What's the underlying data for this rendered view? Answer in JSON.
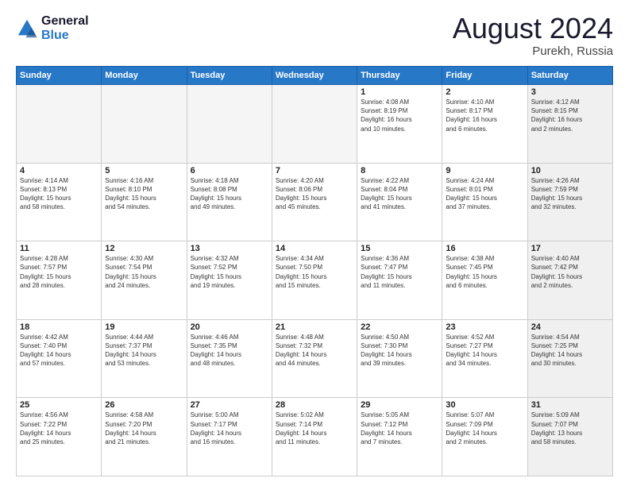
{
  "logo": {
    "line1": "General",
    "line2": "Blue"
  },
  "title": "August 2024",
  "subtitle": "Purekh, Russia",
  "days_header": [
    "Sunday",
    "Monday",
    "Tuesday",
    "Wednesday",
    "Thursday",
    "Friday",
    "Saturday"
  ],
  "weeks": [
    [
      {
        "day": "",
        "info": "",
        "empty": true
      },
      {
        "day": "",
        "info": "",
        "empty": true
      },
      {
        "day": "",
        "info": "",
        "empty": true
      },
      {
        "day": "",
        "info": "",
        "empty": true
      },
      {
        "day": "1",
        "info": "Sunrise: 4:08 AM\nSunset: 8:19 PM\nDaylight: 16 hours\nand 10 minutes."
      },
      {
        "day": "2",
        "info": "Sunrise: 4:10 AM\nSunset: 8:17 PM\nDaylight: 16 hours\nand 6 minutes."
      },
      {
        "day": "3",
        "info": "Sunrise: 4:12 AM\nSunset: 8:15 PM\nDaylight: 16 hours\nand 2 minutes.",
        "shaded": true
      }
    ],
    [
      {
        "day": "4",
        "info": "Sunrise: 4:14 AM\nSunset: 8:13 PM\nDaylight: 15 hours\nand 58 minutes."
      },
      {
        "day": "5",
        "info": "Sunrise: 4:16 AM\nSunset: 8:10 PM\nDaylight: 15 hours\nand 54 minutes."
      },
      {
        "day": "6",
        "info": "Sunrise: 4:18 AM\nSunset: 8:08 PM\nDaylight: 15 hours\nand 49 minutes."
      },
      {
        "day": "7",
        "info": "Sunrise: 4:20 AM\nSunset: 8:06 PM\nDaylight: 15 hours\nand 45 minutes."
      },
      {
        "day": "8",
        "info": "Sunrise: 4:22 AM\nSunset: 8:04 PM\nDaylight: 15 hours\nand 41 minutes."
      },
      {
        "day": "9",
        "info": "Sunrise: 4:24 AM\nSunset: 8:01 PM\nDaylight: 15 hours\nand 37 minutes."
      },
      {
        "day": "10",
        "info": "Sunrise: 4:26 AM\nSunset: 7:59 PM\nDaylight: 15 hours\nand 32 minutes.",
        "shaded": true
      }
    ],
    [
      {
        "day": "11",
        "info": "Sunrise: 4:28 AM\nSunset: 7:57 PM\nDaylight: 15 hours\nand 28 minutes."
      },
      {
        "day": "12",
        "info": "Sunrise: 4:30 AM\nSunset: 7:54 PM\nDaylight: 15 hours\nand 24 minutes."
      },
      {
        "day": "13",
        "info": "Sunrise: 4:32 AM\nSunset: 7:52 PM\nDaylight: 15 hours\nand 19 minutes."
      },
      {
        "day": "14",
        "info": "Sunrise: 4:34 AM\nSunset: 7:50 PM\nDaylight: 15 hours\nand 15 minutes."
      },
      {
        "day": "15",
        "info": "Sunrise: 4:36 AM\nSunset: 7:47 PM\nDaylight: 15 hours\nand 11 minutes."
      },
      {
        "day": "16",
        "info": "Sunrise: 4:38 AM\nSunset: 7:45 PM\nDaylight: 15 hours\nand 6 minutes."
      },
      {
        "day": "17",
        "info": "Sunrise: 4:40 AM\nSunset: 7:42 PM\nDaylight: 15 hours\nand 2 minutes.",
        "shaded": true
      }
    ],
    [
      {
        "day": "18",
        "info": "Sunrise: 4:42 AM\nSunset: 7:40 PM\nDaylight: 14 hours\nand 57 minutes."
      },
      {
        "day": "19",
        "info": "Sunrise: 4:44 AM\nSunset: 7:37 PM\nDaylight: 14 hours\nand 53 minutes."
      },
      {
        "day": "20",
        "info": "Sunrise: 4:46 AM\nSunset: 7:35 PM\nDaylight: 14 hours\nand 48 minutes."
      },
      {
        "day": "21",
        "info": "Sunrise: 4:48 AM\nSunset: 7:32 PM\nDaylight: 14 hours\nand 44 minutes."
      },
      {
        "day": "22",
        "info": "Sunrise: 4:50 AM\nSunset: 7:30 PM\nDaylight: 14 hours\nand 39 minutes."
      },
      {
        "day": "23",
        "info": "Sunrise: 4:52 AM\nSunset: 7:27 PM\nDaylight: 14 hours\nand 34 minutes."
      },
      {
        "day": "24",
        "info": "Sunrise: 4:54 AM\nSunset: 7:25 PM\nDaylight: 14 hours\nand 30 minutes.",
        "shaded": true
      }
    ],
    [
      {
        "day": "25",
        "info": "Sunrise: 4:56 AM\nSunset: 7:22 PM\nDaylight: 14 hours\nand 25 minutes."
      },
      {
        "day": "26",
        "info": "Sunrise: 4:58 AM\nSunset: 7:20 PM\nDaylight: 14 hours\nand 21 minutes."
      },
      {
        "day": "27",
        "info": "Sunrise: 5:00 AM\nSunset: 7:17 PM\nDaylight: 14 hours\nand 16 minutes."
      },
      {
        "day": "28",
        "info": "Sunrise: 5:02 AM\nSunset: 7:14 PM\nDaylight: 14 hours\nand 11 minutes."
      },
      {
        "day": "29",
        "info": "Sunrise: 5:05 AM\nSunset: 7:12 PM\nDaylight: 14 hours\nand 7 minutes."
      },
      {
        "day": "30",
        "info": "Sunrise: 5:07 AM\nSunset: 7:09 PM\nDaylight: 14 hours\nand 2 minutes."
      },
      {
        "day": "31",
        "info": "Sunrise: 5:09 AM\nSunset: 7:07 PM\nDaylight: 13 hours\nand 58 minutes.",
        "shaded": true
      }
    ]
  ]
}
